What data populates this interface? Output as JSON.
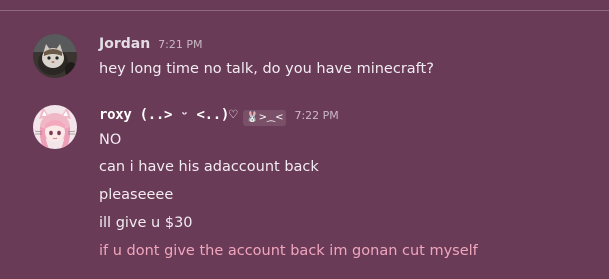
{
  "messages": [
    {
      "username": "Jordan",
      "time": "7:21 PM",
      "lines": [
        "hey long time no talk, do you have minecraft?"
      ]
    },
    {
      "username": "roxy (..> ᵕ <..)♡",
      "badge": "🐰>⁔<",
      "time": "7:22 PM",
      "lines": [
        "NO",
        "can i have his adaccount back",
        "pleaseeee",
        "ill give u $30",
        "if u dont give the account back im gonan cut myself"
      ]
    }
  ],
  "colors": {
    "background": "#6a3b57",
    "text": "#f2ecf2",
    "highlighted_text": "#f0a6bd",
    "timestamp": "#c9b8c5"
  },
  "icons": {
    "jordan_avatar": "cat-photo-avatar",
    "roxy_avatar": "anime-girl-avatar"
  }
}
